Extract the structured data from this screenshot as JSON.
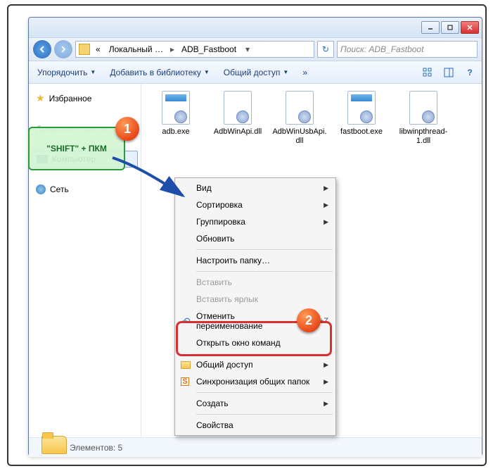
{
  "window_controls": {
    "min": "minimize",
    "max": "maximize",
    "close": "close"
  },
  "nav": {
    "back": "back",
    "forward": "forward",
    "crumb_prefix": "«",
    "crumb1": "Локальный …",
    "crumb2": "ADB_Fastboot",
    "refresh": "refresh",
    "search_placeholder": "Поиск: ADB_Fastboot"
  },
  "toolbar": {
    "organize": "Упорядочить",
    "library": "Добавить в библиотеку",
    "share": "Общий доступ",
    "burn": "»",
    "view": "view",
    "preview": "preview",
    "help": "?"
  },
  "sidebar": {
    "favorites": "Избранное",
    "homegroup": "Домашняя группа",
    "computer": "Компьютер",
    "network": "Сеть"
  },
  "files": [
    {
      "name": "adb.exe",
      "type": "exe"
    },
    {
      "name": "AdbWinApi.dll",
      "type": "dll"
    },
    {
      "name": "AdbWinUsbApi.dll",
      "type": "dll"
    },
    {
      "name": "fastboot.exe",
      "type": "exe"
    },
    {
      "name": "libwinpthread-1.dll",
      "type": "dll"
    }
  ],
  "status": {
    "text": "Элементов: 5"
  },
  "context_menu": {
    "view": "Вид",
    "sort": "Сортировка",
    "group": "Группировка",
    "refresh": "Обновить",
    "customize": "Настроить папку…",
    "paste": "Вставить",
    "paste_shortcut": "Вставить ярлык",
    "undo": "Отменить переименование",
    "undo_key": "CTRL+Z",
    "open_cmd": "Открыть окно команд",
    "share": "Общий доступ",
    "sync": "Синхронизация общих папок",
    "create": "Создать",
    "properties": "Свойства"
  },
  "annotation": {
    "badge1": "1",
    "badge2": "2",
    "hint": "\"SHIFT\" + ПКМ"
  }
}
